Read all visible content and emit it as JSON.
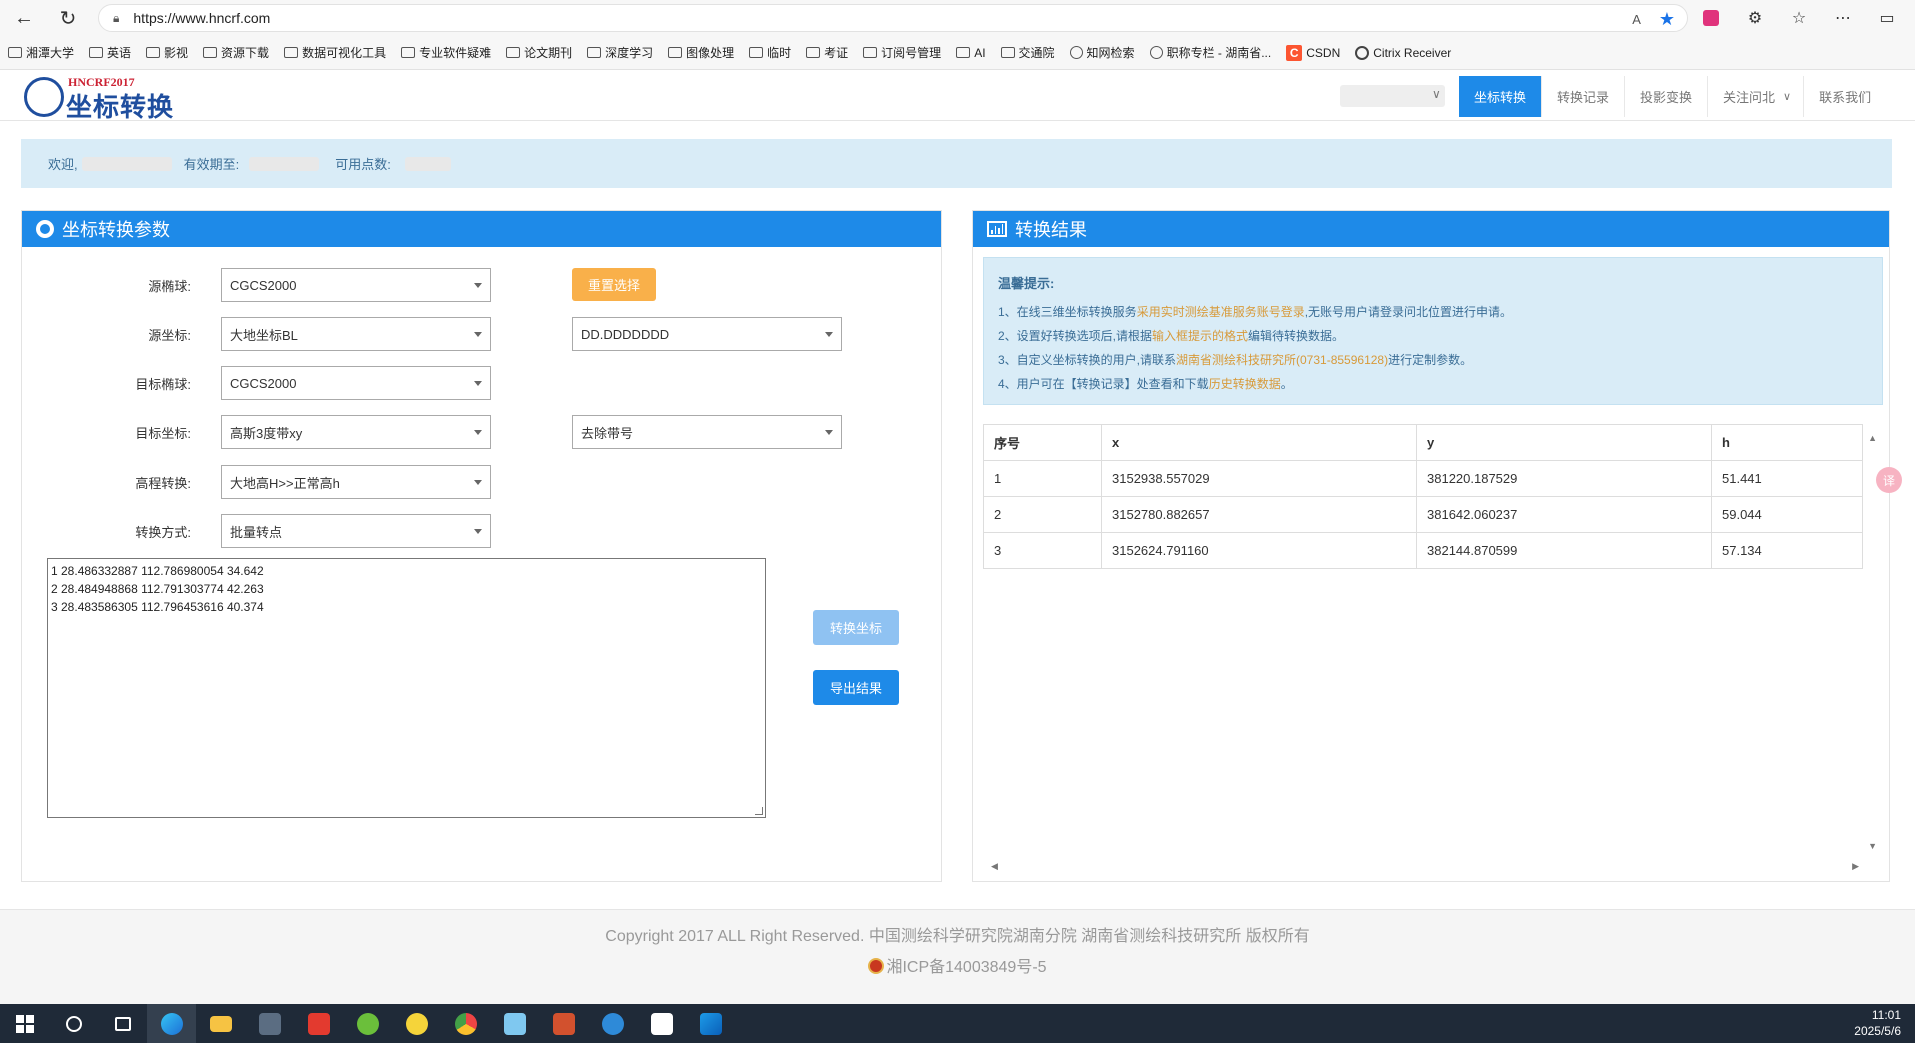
{
  "browser": {
    "url": "https://www.hncrf.com",
    "bookmarks": [
      {
        "label": "湘潭大学",
        "icon": "folder-icon"
      },
      {
        "label": "英语",
        "icon": "folder-icon"
      },
      {
        "label": "影视",
        "icon": "folder-icon"
      },
      {
        "label": "资源下载",
        "icon": "folder-icon"
      },
      {
        "label": "数据可视化工具",
        "icon": "folder-icon"
      },
      {
        "label": "专业软件疑难",
        "icon": "folder-icon"
      },
      {
        "label": "论文期刊",
        "icon": "folder-icon"
      },
      {
        "label": "深度学习",
        "icon": "folder-icon"
      },
      {
        "label": "图像处理",
        "icon": "folder-icon"
      },
      {
        "label": "临时",
        "icon": "folder-icon"
      },
      {
        "label": "考证",
        "icon": "folder-icon"
      },
      {
        "label": "订阅号管理",
        "icon": "folder-icon"
      },
      {
        "label": "AI",
        "icon": "folder-icon"
      },
      {
        "label": "交通院",
        "icon": "folder-icon"
      },
      {
        "label": "知网检索",
        "icon": "globe-icon"
      },
      {
        "label": "职称专栏 - 湖南省...",
        "icon": "globe-icon"
      },
      {
        "label": "CSDN",
        "icon": "csdn-icon"
      },
      {
        "label": "Citrix Receiver",
        "icon": "citrix-icon"
      }
    ]
  },
  "site": {
    "logo_small": "HNCRF2017",
    "logo_title": "坐标转换",
    "nav": [
      "坐标转换",
      "转换记录",
      "投影变换",
      "关注问北",
      "联系我们"
    ],
    "welcome": {
      "greet": "欢迎,",
      "expiry_label": "有效期至:",
      "points_label": "可用点数:"
    }
  },
  "params": {
    "title": "坐标转换参数",
    "source_ellipsoid_label": "源椭球:",
    "source_ellipsoid_value": "CGCS2000",
    "reset_label": "重置选择",
    "source_coord_label": "源坐标:",
    "source_coord_value": "大地坐标BL",
    "source_format_value": "DD.DDDDDDD",
    "target_ellipsoid_label": "目标椭球:",
    "target_ellipsoid_value": "CGCS2000",
    "target_coord_label": "目标坐标:",
    "target_coord_value": "高斯3度带xy",
    "target_band_value": "去除带号",
    "height_label": "高程转换:",
    "height_value": "大地高H>>正常高h",
    "mode_label": "转换方式:",
    "mode_value": "批量转点",
    "input_lines": [
      "1 28.486332887 112.786980054 34.642",
      "2 28.484948868 112.791303774 42.263",
      "3 28.483586305 112.796453616 40.374"
    ],
    "convert_label": "转换坐标",
    "export_label": "导出结果"
  },
  "results": {
    "title": "转换结果",
    "tips_title": "温馨提示:",
    "tips": [
      {
        "pre": "1、在线三维坐标转换服务",
        "hl": "采用实时测绘基准服务账号登录",
        "post": ",无账号用户请登录问北位置进行申请。"
      },
      {
        "pre": "2、设置好转换选项后,请根据",
        "hl": "输入框提示的格式",
        "post": "编辑待转换数据。"
      },
      {
        "pre": "3、自定义坐标转换的用户,请联系",
        "hl": "湖南省测绘科技研究所(0731-85596128)",
        "post": "进行定制参数。"
      },
      {
        "pre": "4、用户可在【转换记录】处查看和下载",
        "hl": "历史转换数据",
        "post": "。"
      }
    ],
    "columns": [
      "序号",
      "x",
      "y",
      "h"
    ],
    "rows": [
      [
        "1",
        "3152938.557029",
        "381220.187529",
        "51.441"
      ],
      [
        "2",
        "3152780.882657",
        "381642.060237",
        "59.044"
      ],
      [
        "3",
        "3152624.791160",
        "382144.870599",
        "57.134"
      ]
    ]
  },
  "footer": {
    "copyright": "Copyright 2017 ALL Right Reserved. 中国测绘科学研究院湖南分院 湖南省测绘科技研究所 版权所有",
    "icp": "湘ICP备14003849号-5"
  },
  "taskbar": {
    "time": "11:01",
    "date": "2025/5/6"
  }
}
